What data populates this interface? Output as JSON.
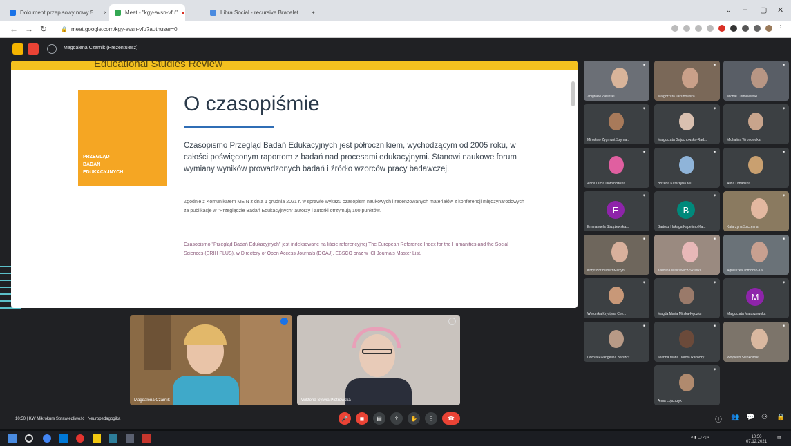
{
  "browser": {
    "tabs": [
      {
        "title": "Dokument przepisowy nowy 5 ...",
        "color": "#1a73e8"
      },
      {
        "title": "Meet - \"kgy-avsn-vfu\"",
        "color": "#34a853"
      },
      {
        "title": "Libra Social - recursive Bracelet ...",
        "color": "#4a8be0"
      }
    ],
    "new_tab": "+",
    "url": "meet.google.com/kgy-avsn-vfu?authuser=0"
  },
  "meet": {
    "organizer": "Magdalena Czarnik (Prezentujesz)",
    "presentation": {
      "header": "Educational Studies Review",
      "cover_text": [
        "PRZEGLĄD",
        "BADAŃ",
        "EDUKACYJNYCH"
      ],
      "title": "O czasopiśmie",
      "lead": "Czasopismo Przegląd Badań Edukacyjnych jest półrocznikiem, wychodzącym od 2005 roku, w całości poświęconym raportom z badań nad procesami edukacyjnymi. Stanowi naukowe forum wymiany wyników prowadzonych badań i źródło wzorców pracy badawczej.",
      "para2": "Zgodnie z Komunikatem MEiN z dnia 1 grudnia 2021 r. w sprawie wykazu czasopism naukowych i recenzowanych materiałów z konferencji międzynarodowych za publikacje w \"Przeglądzie Badań Edukacyjnych\" autorzy i autorki otrzymują 100 punktów.",
      "para3": "Czasopismo \"Przegląd Badań Edukacyjnych\" jest indeksowane na liście referencyjnej The European Reference Index for the Humanities and the Social Sciences (ERIH PLUS), w Directory of Open Access Journals (DOAJ), EBSCO oraz w ICI Journals Master List."
    },
    "main_videos": [
      {
        "name": "Magdalena Czarnik"
      },
      {
        "name": "Wiktoria Sylwia Piotrowska"
      }
    ],
    "participants": [
      {
        "name": "Zbigniew Zielinski",
        "type": "video",
        "bg": "#6b6f76",
        "face": "#d8b49a"
      },
      {
        "name": "Małgorzata Jakubowska",
        "type": "video",
        "bg": "#7a6858",
        "face": "#c9a089"
      },
      {
        "name": "Michał Chmielewski",
        "type": "video",
        "bg": "#595e66",
        "face": "#b89684"
      },
      {
        "name": "Mirosław Zygmunt Szyma...",
        "type": "face",
        "face": "#a87a5a"
      },
      {
        "name": "Małgorzata Gajuchowska-Rad...",
        "type": "face",
        "face": "#d9c0b0"
      },
      {
        "name": "Michalina Wronowska",
        "type": "face",
        "face": "#c8a48c"
      },
      {
        "name": "Anna Lucia Dominowska...",
        "type": "face",
        "face": "#e05fa0"
      },
      {
        "name": "Bożena Katarzyna Ku...",
        "type": "face",
        "face": "#8fb4d9"
      },
      {
        "name": "Alina Limańska",
        "type": "face",
        "face": "#c9a070"
      },
      {
        "name": "Emmanuela Strzyżewska...",
        "type": "avatar",
        "letter": "E",
        "color": "#8e24aa"
      },
      {
        "name": "Bartosz Hakaga Kapelimo Ka...",
        "type": "avatar",
        "letter": "B",
        "color": "#00897b"
      },
      {
        "name": "Katarzyna Szczęsna",
        "type": "video",
        "bg": "#8a7a60",
        "face": "#e3b8a0"
      },
      {
        "name": "Krzysztof Hubert Martyn...",
        "type": "video",
        "bg": "#6e665c",
        "face": "#d8b09c"
      },
      {
        "name": "Karolina Walkiewicz-Skulska",
        "type": "video",
        "bg": "#9a8a80",
        "face": "#e8b8b8"
      },
      {
        "name": "Agnieszka Tomczak-Ka...",
        "type": "video",
        "bg": "#6a7278",
        "face": "#c8a090"
      },
      {
        "name": "Weronika Krystyna Cze...",
        "type": "face",
        "face": "#c89878"
      },
      {
        "name": "Magda Maria Mirska-Kędzior",
        "type": "face",
        "face": "#9a7a6a"
      },
      {
        "name": "Małgorzata Matuszewska",
        "type": "avatar",
        "letter": "M",
        "color": "#8e24aa"
      },
      {
        "name": "Dorota Ewangelina Barszcz...",
        "type": "face",
        "face": "#b89a86"
      },
      {
        "name": "Joanna Maria Dorota Rakoczy...",
        "type": "face",
        "face": "#6b4a3a"
      },
      {
        "name": "Wojciech Sieńkowski",
        "type": "video",
        "bg": "#7c746a",
        "face": "#d9b8a0"
      },
      {
        "name": "Anna Łojszczyk",
        "type": "face",
        "face": "#b08a6e"
      }
    ],
    "controls": {
      "time_meeting": "10:50 | KW Mikrokurs Sprawiedliwość i Neuropedagogika",
      "buttons": [
        "mic",
        "camera",
        "captions",
        "present",
        "hand",
        "more",
        "leave"
      ]
    }
  },
  "taskbar": {
    "time": "10:50",
    "date": "07.12.2021"
  }
}
